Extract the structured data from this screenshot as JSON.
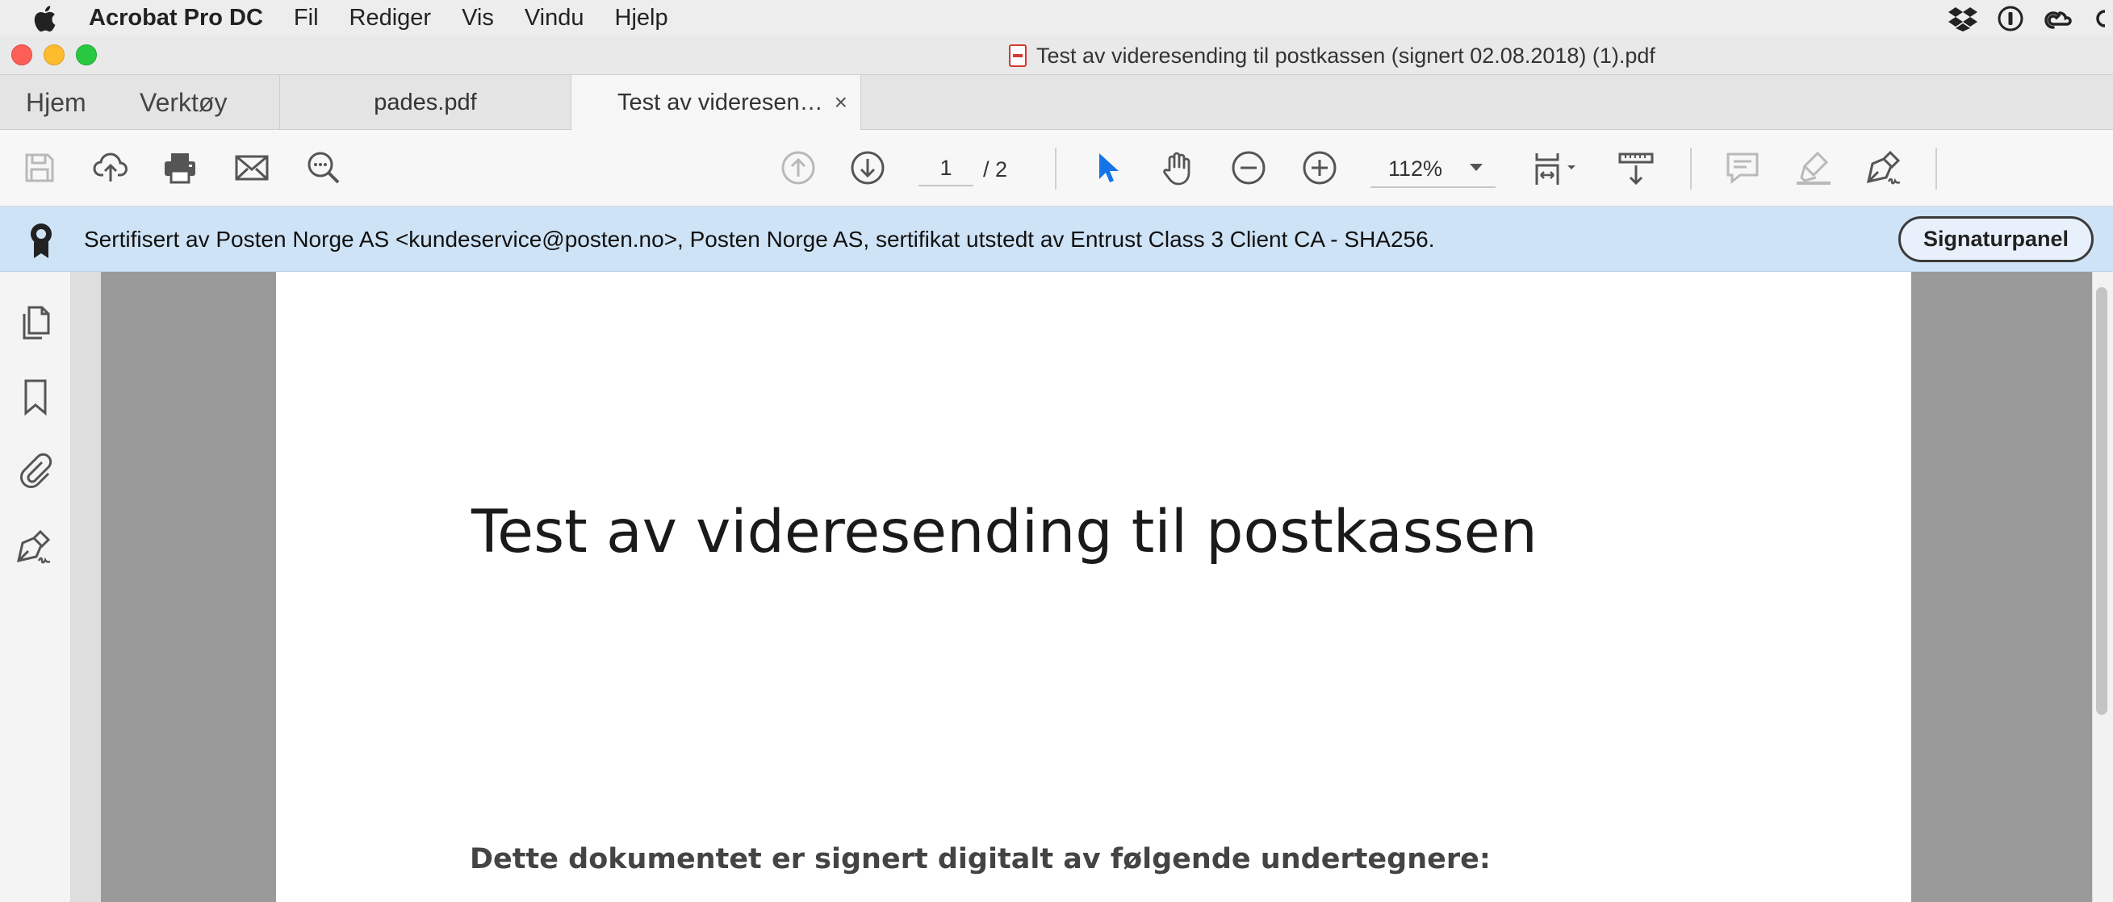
{
  "menubar": {
    "app_name": "Acrobat Pro DC",
    "items": [
      "Fil",
      "Rediger",
      "Vis",
      "Vindu",
      "Hjelp"
    ]
  },
  "window": {
    "title": "Test av videresending til postkassen (signert 02.08.2018) (1).pdf"
  },
  "tabs": {
    "home": "Hjem",
    "tools": "Verktøy",
    "documents": [
      {
        "label": "pades.pdf",
        "active": false
      },
      {
        "label": "Test av videresen…",
        "active": true,
        "close": "×"
      }
    ]
  },
  "toolbar": {
    "page_current": "1",
    "page_total": "/ 2",
    "zoom": "112%"
  },
  "signature_bar": {
    "message": "Sertifisert av Posten Norge AS <kundeservice@posten.no>, Posten Norge AS, sertifikat utstedt av Entrust Class 3 Client CA - SHA256.",
    "button": "Signaturpanel"
  },
  "document": {
    "title": "Test av videresending til postkassen",
    "subtitle": "Dette dokumentet er signert digitalt av følgende undertegnere:"
  },
  "colors": {
    "accent_blue": "#1473e6",
    "banner_bg": "#cfe3f6"
  }
}
